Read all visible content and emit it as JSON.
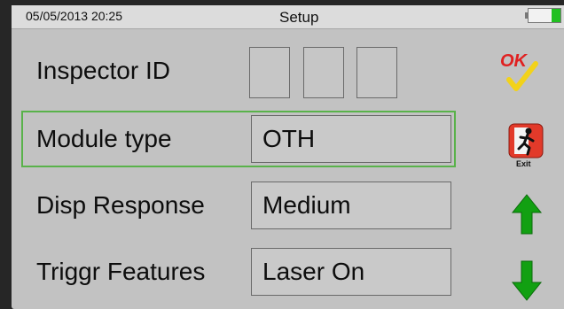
{
  "status_bar": {
    "datetime": "05/05/2013 20:25",
    "title": "Setup",
    "battery_icon": "battery-icon"
  },
  "form": {
    "inspector_id": {
      "label": "Inspector ID",
      "digits": [
        "",
        "",
        ""
      ]
    },
    "module_type": {
      "label": "Module type",
      "value": "OTH",
      "selected": true
    },
    "disp_response": {
      "label": "Disp Response",
      "value": "Medium"
    },
    "triggr_features": {
      "label": "Triggr Features",
      "value": "Laser On"
    }
  },
  "side_buttons": {
    "ok": {
      "label": "OK",
      "icon": "ok-checkmark-icon"
    },
    "exit": {
      "label": "Exit",
      "icon": "exit-running-man-icon"
    },
    "up": {
      "icon": "arrow-up-icon"
    },
    "down": {
      "icon": "arrow-down-icon"
    }
  },
  "colors": {
    "selection_border": "#59b24a",
    "arrow_green": "#12a012",
    "ok_red": "#e02020",
    "check_yellow": "#f2d21a",
    "exit_red": "#e23a2a",
    "battery_green": "#20c020"
  }
}
